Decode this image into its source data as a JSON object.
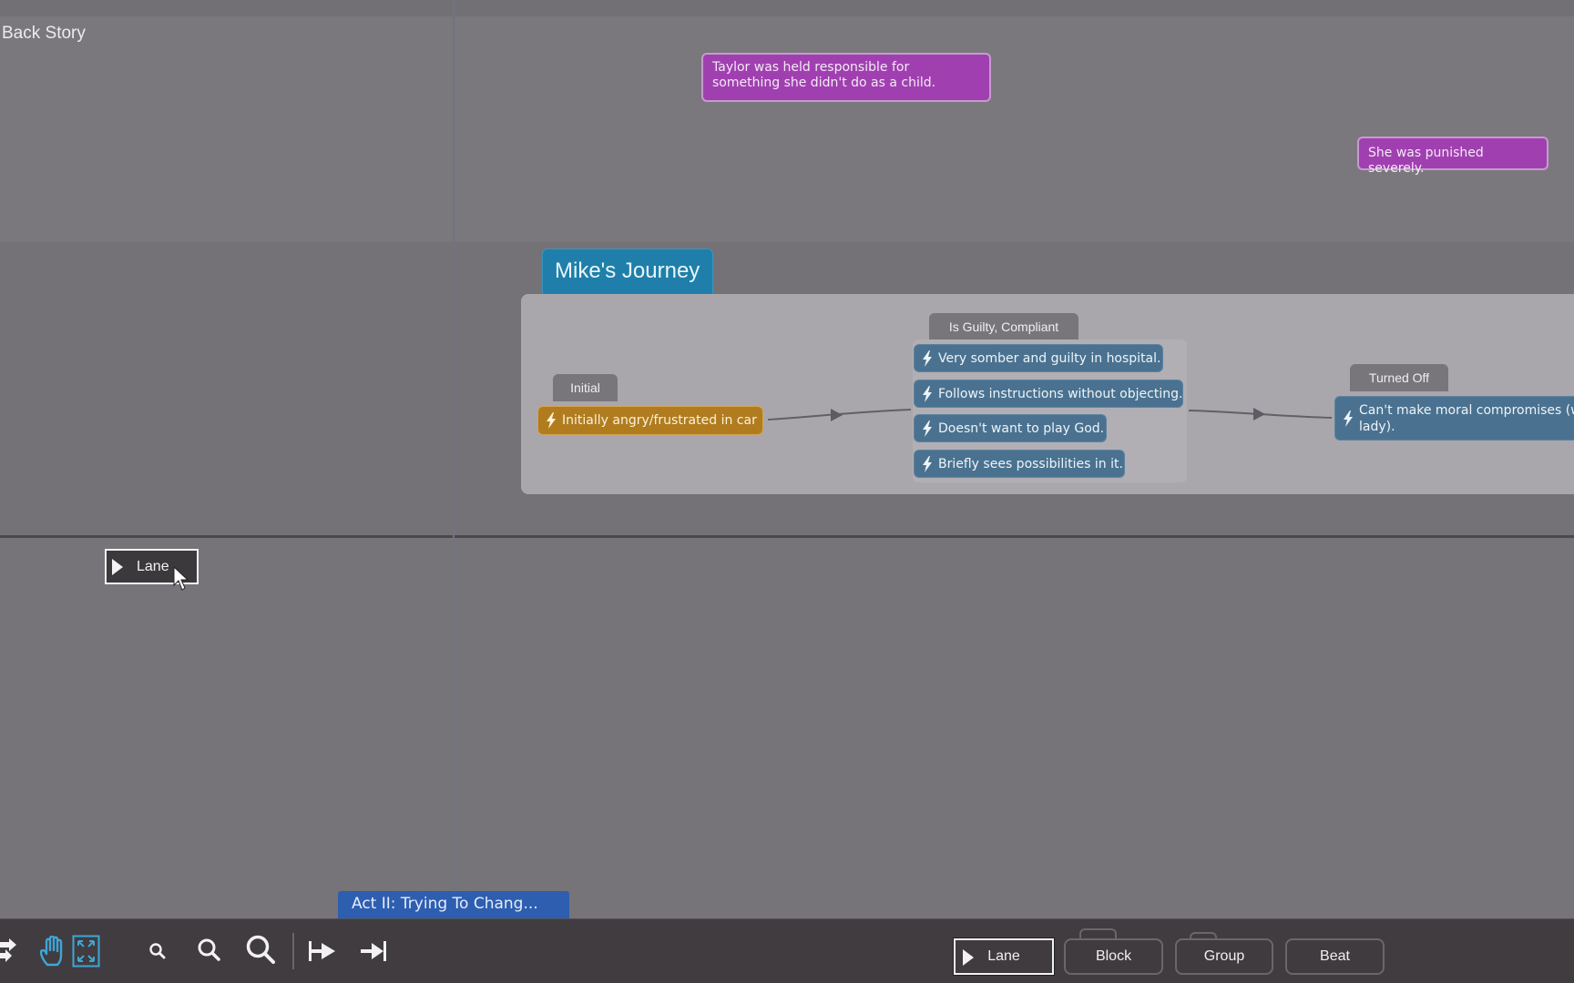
{
  "lanes": {
    "back_story": {
      "title": "Back Story",
      "cards": [
        {
          "text": "Taylor was held responsible for something she didn't do as a child."
        },
        {
          "text": "She was punished severely."
        }
      ]
    },
    "journey": {
      "title": "Mike's Journey",
      "groups": [
        {
          "label": "Initial",
          "beats": [
            "Initially angry/frustrated in car"
          ]
        },
        {
          "label": "Is Guilty, Compliant",
          "beats": [
            "Very somber and guilty in hospital.",
            "Follows instructions without objecting.",
            "Doesn't want to play God.",
            "Briefly sees possibilities in it."
          ]
        },
        {
          "label": "Turned Off",
          "beats": [
            "Can't make moral compromises (w... lady)."
          ]
        }
      ]
    }
  },
  "beat_texts": {
    "turned_off_line1": "Can't make moral compromises (w",
    "turned_off_line2": "lady)."
  },
  "drag_ghost": {
    "label": "Lane"
  },
  "act_marker": {
    "label": "Act II: Trying To Chang..."
  },
  "toolbar": {
    "tools": [
      {
        "name": "swap-arrows-icon"
      },
      {
        "name": "hand-pan-icon",
        "active": true
      },
      {
        "name": "fit-to-screen-icon",
        "active": true
      },
      {
        "name": "zoom-small-icon"
      },
      {
        "name": "zoom-medium-icon"
      },
      {
        "name": "zoom-large-icon"
      },
      {
        "name": "step-to-start-icon"
      },
      {
        "name": "jump-to-end-icon"
      }
    ],
    "add_buttons": {
      "lane": "Lane",
      "block": "Block",
      "group": "Group",
      "beat": "Beat"
    }
  },
  "colors": {
    "backstory_card": "#a040b0",
    "journey_tab": "#1f7faa",
    "beat_blue": "#4a7290",
    "beat_orange": "#b07c1e",
    "act_marker": "#2e5eb0",
    "tool_active": "#3ea6d6"
  }
}
